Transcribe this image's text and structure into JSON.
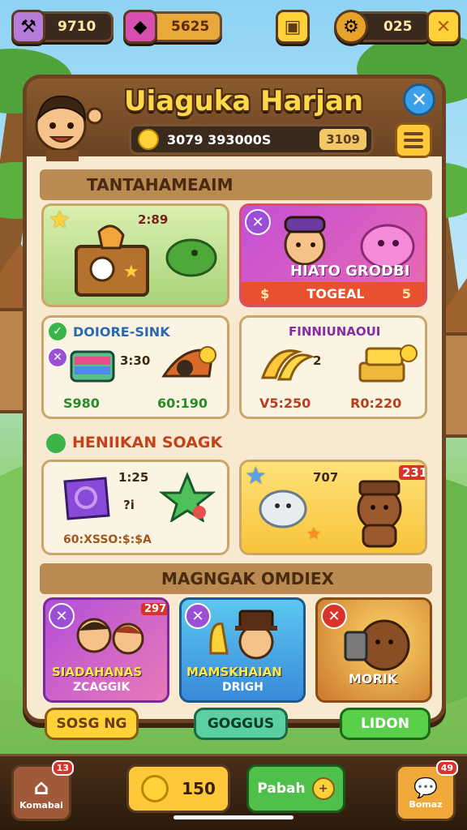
{
  "top_bar": {
    "left_value": "9710",
    "gem_value": "5625",
    "right_value": "025",
    "left_icon": "hammer-icon",
    "gem_icon": "gem-icon",
    "quest_icon": "scroll-icon",
    "gear_icon": "gear-icon",
    "close_icon": "close-icon"
  },
  "panel": {
    "title": "Uiaguka Harjan",
    "coins_amount": "3079 393000S",
    "coins_chip": "3109",
    "close_icon": "close-icon",
    "menu_icon": "menu-icon"
  },
  "sections": {
    "first": "TANTAHAMEAIM",
    "second_left": "DOIORE-SINK",
    "second_right": "FINNIUNAOUI",
    "third": "HENIIKAN SOAGK",
    "fourth": "MAGNGAK OMDIEX"
  },
  "cards": {
    "crate_tag": "2:89",
    "promo_title": "HIATO GRODBI",
    "promo_sub": "TOGEAL",
    "promo_price_left": "$",
    "promo_price_right": "5",
    "bundle_left_value": "3:30",
    "bundle_left_price": "S980",
    "bundle_right_price": "60:190",
    "bundle2_left_value": "2",
    "bundle2_left_price": "V5:250",
    "bundle2_right_price": "R0:220",
    "candy_top": "1:25",
    "candy_mid": "?i",
    "candy_price": "60:XSSO:$:$A",
    "bear_top": "707",
    "bear_tag": "231",
    "friends_label": "SIADAHANAS",
    "friends_sub": "ZCAGGIK",
    "friends_tag": "297",
    "hat_label": "MAMSKHAIAN",
    "hat_sub": "DRIGH",
    "sack_label": "MORIK"
  },
  "footer_buttons": {
    "left": "SOSG NG",
    "middle": "GOGGUS",
    "right": "LIDON"
  },
  "bottom_nav": {
    "home_label": "Komabai",
    "home_badge": "13",
    "coins_value": "150",
    "pabah_label": "Pabah",
    "chat_label": "Bomaz",
    "chat_badge": "49"
  },
  "colors": {
    "panel_bg": "#f7ead0",
    "panel_border": "#6b4323",
    "title": "#ffd84a",
    "accent_green": "#3bb44a",
    "accent_yellow": "#ffc83a"
  }
}
